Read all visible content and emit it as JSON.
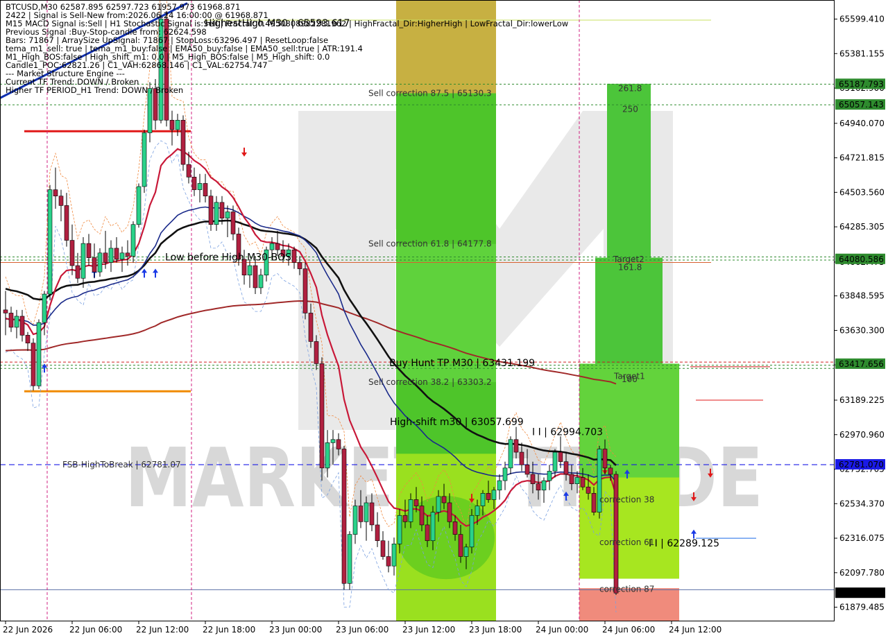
{
  "chart_data": {
    "type": "candlestick",
    "symbol": "BTCUSD",
    "timeframe": "M30",
    "watermark": "MARKETZ TRADE",
    "price_axis": {
      "range": [
        61790,
        65720
      ],
      "ticks": [
        65599.41,
        65381.155,
        65162.9,
        64940.07,
        64721.815,
        64503.56,
        64285.305,
        64062.475,
        63848.595,
        63630.3,
        63412.045,
        63189.225,
        62970.96,
        62752.705,
        62534.37,
        62316.075,
        62097.78,
        61879.485
      ],
      "tick_labels": [
        "65599.410",
        "65381.155",
        "65162.900",
        "64940.070",
        "64721.815",
        "64503.560",
        "64285.305",
        "64062.475",
        "63848.595",
        "63630.300",
        "63412.045",
        "63189.225",
        "62970.960",
        "62752.705",
        "62534.370",
        "62316.075",
        "62097.780",
        "61879.485"
      ]
    },
    "time_axis": {
      "labels": [
        "22 Jun 2026",
        "22 Jun 06:00",
        "22 Jun 12:00",
        "22 Jun 18:00",
        "23 Jun 00:00",
        "23 Jun 06:00",
        "23 Jun 12:00",
        "23 Jun 18:00",
        "24 Jun 00:00",
        "24 Jun 06:00",
        "24 Jun 12:00"
      ],
      "bar_index": [
        0,
        12,
        24,
        36,
        48,
        60,
        72,
        84,
        96,
        108,
        120
      ]
    },
    "price_tags": [
      {
        "value": 65187.793,
        "label": "65187.793",
        "color": "#2e8b2e"
      },
      {
        "value": 65057.143,
        "label": "65057.143",
        "color": "#2e8b2e"
      },
      {
        "value": 64080.586,
        "label": "64080.586",
        "color": "#2e8b2e"
      },
      {
        "value": 63417.656,
        "label": "63417.656",
        "color": "#2e8b2e"
      },
      {
        "value": 62781.07,
        "label": "62781.070",
        "color": "#1a1ae6"
      },
      {
        "value": 61968.871,
        "label": "61968.871",
        "color": "#000000"
      }
    ],
    "info_lines": [
      "BTCUSD,M30  62587.895 62597.723 61957.973 61968.871",
      "2422 | Signal is Sell-New from:2026.06.24 16:00:00 @ 61968.871",
      "M15 MACD Signal is:Sell | H1 Stochastic Signal is:Sell | Fractal: 0.4950808982281962 | HighFractal_Dir:HigherHigh | LowFractal_Dir:lowerLow",
      "Previous Signal :Buy-Stop-candle from: 62624.598",
      "Bars: 71867 | ArraySize UpSignal: 71867 | StopLoss:63296.497 | ResetLoop:false",
      "tema_m1_sell: true | tema_m1_buy:false | EMA50_buy:false | EMA50_sell:true | ATR:191.4",
      "M1_High_BOS:false | High_shift_m1: 0.0 | M5_High_BOS:false | M5_High_shift: 0.0",
      "Candle1_POC:62821.26 | C1_VAH:62868.146 | C1_VAL:62754.747",
      "--- Market Structure Engine ---",
      "Current TF Trend: DOWN / Broken",
      "Higher TF PERIOD_H1 Trend: DOWN / Broken"
    ],
    "annotations": [
      {
        "text": "HighestHigh   M30 | 65593.617",
        "price": 65593.617
      },
      {
        "text": "Sell correction 87.5 | 65130.3",
        "price": 65130.3
      },
      {
        "text": "Sell correction 61.8 | 64177.8",
        "price": 64177.8
      },
      {
        "text": "Low before High   M30-BOS",
        "price": 64100
      },
      {
        "text": "Buy Hunt TP M30 | 63431.199",
        "price": 63431.199
      },
      {
        "text": "I I | 62994.703",
        "price": 62994.703
      },
      {
        "text": "Sell correction 38.2 | 63303.2",
        "price": 63303.2
      },
      {
        "text": "High-shift m30 | 63057.699",
        "price": 63057.699
      },
      {
        "text": "FSB-HighToBreak | 62781.07",
        "price": 62781.07
      },
      {
        "text": "I I | 62289.125",
        "price": 62289.125
      },
      {
        "text": "correction 38",
        "price": 62560
      },
      {
        "text": "correction 61",
        "price": 62290
      },
      {
        "text": "correction 87",
        "price": 61995
      },
      {
        "text": "261.8",
        "price": 65160
      },
      {
        "text": "250",
        "price": 65030
      },
      {
        "text": "Target2",
        "price": 64080
      },
      {
        "text": "161.8",
        "price": 64030
      },
      {
        "text": "Target1",
        "price": 63340
      },
      {
        "text": "100",
        "price": 63320
      }
    ],
    "candles": [
      [
        63760,
        63880,
        63600,
        63740
      ],
      [
        63740,
        63780,
        63620,
        63650
      ],
      [
        63650,
        63760,
        63580,
        63720
      ],
      [
        63720,
        63760,
        63560,
        63600
      ],
      [
        63600,
        63620,
        63500,
        63550
      ],
      [
        63550,
        63580,
        63250,
        63280
      ],
      [
        63280,
        63700,
        63260,
        63680
      ],
      [
        63680,
        63880,
        63600,
        63860
      ],
      [
        63860,
        64550,
        63820,
        64520
      ],
      [
        64520,
        64660,
        64400,
        64480
      ],
      [
        64480,
        64520,
        64320,
        64420
      ],
      [
        64420,
        64500,
        64160,
        64200
      ],
      [
        64200,
        64300,
        63980,
        64040
      ],
      [
        64040,
        64120,
        63930,
        63960
      ],
      [
        63960,
        64220,
        63900,
        64180
      ],
      [
        64180,
        64240,
        64040,
        64090
      ],
      [
        64090,
        64180,
        63960,
        64000
      ],
      [
        64000,
        64150,
        63970,
        64120
      ],
      [
        64120,
        64260,
        64020,
        64060
      ],
      [
        64060,
        64200,
        64000,
        64150
      ],
      [
        64150,
        64220,
        64060,
        64080
      ],
      [
        64080,
        64160,
        64000,
        64120
      ],
      [
        64120,
        64200,
        64040,
        64100
      ],
      [
        64100,
        64320,
        64060,
        64300
      ],
      [
        64300,
        64560,
        64280,
        64540
      ],
      [
        64540,
        64900,
        64500,
        64880
      ],
      [
        64880,
        65200,
        64820,
        65160
      ],
      [
        65160,
        65220,
        64900,
        64960
      ],
      [
        64960,
        65700,
        64940,
        65600
      ],
      [
        65600,
        65650,
        64920,
        64960
      ],
      [
        64960,
        65020,
        64800,
        64900
      ],
      [
        64900,
        65000,
        64860,
        64960
      ],
      [
        64960,
        64990,
        64640,
        64680
      ],
      [
        64680,
        64760,
        64560,
        64600
      ],
      [
        64600,
        64660,
        64480,
        64520
      ],
      [
        64520,
        64620,
        64440,
        64560
      ],
      [
        64560,
        64620,
        64440,
        64480
      ],
      [
        64480,
        64520,
        64260,
        64300
      ],
      [
        64300,
        64480,
        64260,
        64440
      ],
      [
        64440,
        64480,
        64300,
        64340
      ],
      [
        64340,
        64420,
        64220,
        64380
      ],
      [
        64380,
        64420,
        64200,
        64240
      ],
      [
        64240,
        64280,
        64040,
        64080
      ],
      [
        64080,
        64140,
        63920,
        63980
      ],
      [
        63980,
        64080,
        63900,
        64040
      ],
      [
        64040,
        64100,
        63860,
        63900
      ],
      [
        63900,
        64020,
        63860,
        63980
      ],
      [
        63980,
        64160,
        63940,
        64140
      ],
      [
        64140,
        64220,
        64080,
        64180
      ],
      [
        64180,
        64260,
        64100,
        64140
      ],
      [
        64140,
        64200,
        64060,
        64100
      ],
      [
        64100,
        64180,
        64040,
        64140
      ],
      [
        64140,
        64160,
        64020,
        64060
      ],
      [
        64060,
        64100,
        63980,
        64020
      ],
      [
        64020,
        64060,
        63700,
        63740
      ],
      [
        63740,
        63800,
        63520,
        63560
      ],
      [
        63560,
        63600,
        63380,
        63420
      ],
      [
        63420,
        63460,
        62680,
        62760
      ],
      [
        62760,
        63000,
        62700,
        62920
      ],
      [
        62920,
        63000,
        62780,
        62940
      ],
      [
        62940,
        62980,
        62840,
        62880
      ],
      [
        62880,
        62900,
        61990,
        62030
      ],
      [
        62030,
        62360,
        61990,
        62340
      ],
      [
        62340,
        62560,
        62280,
        62520
      ],
      [
        62520,
        62620,
        62380,
        62420
      ],
      [
        62420,
        62580,
        62300,
        62540
      ],
      [
        62540,
        62600,
        62360,
        62400
      ],
      [
        62400,
        62480,
        62260,
        62300
      ],
      [
        62300,
        62360,
        62180,
        62200
      ],
      [
        62200,
        62300,
        62100,
        62140
      ],
      [
        62140,
        62320,
        62080,
        62280
      ],
      [
        62280,
        62500,
        62220,
        62460
      ],
      [
        62460,
        62560,
        62380,
        62420
      ],
      [
        62420,
        62600,
        62380,
        62560
      ],
      [
        62560,
        62640,
        62480,
        62520
      ],
      [
        62520,
        62580,
        62360,
        62400
      ],
      [
        62400,
        62460,
        62260,
        62300
      ],
      [
        62300,
        62520,
        62240,
        62480
      ],
      [
        62480,
        62620,
        62420,
        62580
      ],
      [
        62580,
        62660,
        62500,
        62540
      ],
      [
        62540,
        62600,
        62380,
        62420
      ],
      [
        62420,
        62460,
        62300,
        62340
      ],
      [
        62340,
        62400,
        62160,
        62200
      ],
      [
        62200,
        62280,
        62120,
        62260
      ],
      [
        62260,
        62500,
        62220,
        62460
      ],
      [
        62460,
        62560,
        62400,
        62520
      ],
      [
        62520,
        62620,
        62460,
        62600
      ],
      [
        62600,
        62680,
        62540,
        62560
      ],
      [
        62560,
        62640,
        62500,
        62620
      ],
      [
        62620,
        62720,
        62560,
        62680
      ],
      [
        62680,
        62800,
        62620,
        62760
      ],
      [
        62760,
        62960,
        62720,
        62940
      ],
      [
        62940,
        63020,
        62820,
        62860
      ],
      [
        62860,
        62920,
        62740,
        62780
      ],
      [
        62780,
        62880,
        62700,
        62720
      ],
      [
        62720,
        62800,
        62600,
        62660
      ],
      [
        62660,
        62720,
        62560,
        62620
      ],
      [
        62620,
        62700,
        62540,
        62680
      ],
      [
        62680,
        62780,
        62620,
        62740
      ],
      [
        62740,
        62880,
        62700,
        62860
      ],
      [
        62860,
        62960,
        62760,
        62800
      ],
      [
        62800,
        62860,
        62680,
        62720
      ],
      [
        62720,
        62780,
        62620,
        62660
      ],
      [
        62660,
        62740,
        62600,
        62700
      ],
      [
        62700,
        62760,
        62620,
        62640
      ],
      [
        62640,
        62720,
        62560,
        62600
      ],
      [
        62600,
        62640,
        62460,
        62480
      ],
      [
        62480,
        62900,
        62440,
        62880
      ],
      [
        62880,
        62940,
        62720,
        62760
      ],
      [
        62760,
        62780,
        62680,
        62720
      ],
      [
        62720,
        62740,
        61957,
        61969
      ]
    ]
  }
}
